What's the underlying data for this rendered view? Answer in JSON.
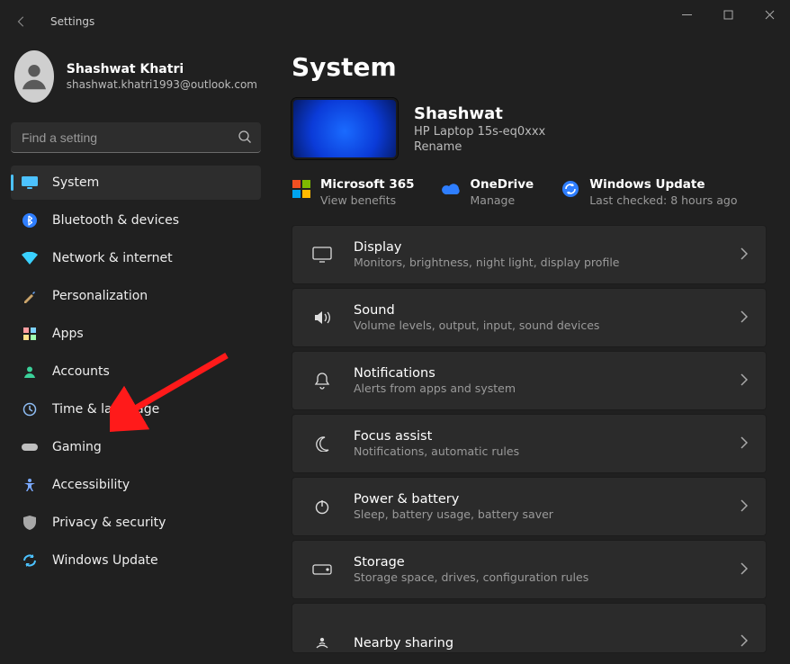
{
  "window": {
    "title": "Settings"
  },
  "user": {
    "name": "Shashwat Khatri",
    "email": "shashwat.khatri1993@outlook.com"
  },
  "search": {
    "placeholder": "Find a setting"
  },
  "nav": [
    {
      "id": "system",
      "label": "System",
      "icon": "🖥️",
      "iconColor": "#4cc2ff",
      "active": true
    },
    {
      "id": "bluetooth",
      "label": "Bluetooth & devices",
      "icon": "BT",
      "iconColor": "#4cc2ff"
    },
    {
      "id": "network",
      "label": "Network & internet",
      "icon": "📶",
      "iconColor": "#4cc2ff"
    },
    {
      "id": "personalization",
      "label": "Personalization",
      "icon": "🖌️",
      "iconColor": "#c9a36a"
    },
    {
      "id": "apps",
      "label": "Apps",
      "icon": "▦",
      "iconColor": "#ff9ea0"
    },
    {
      "id": "accounts",
      "label": "Accounts",
      "icon": "👤",
      "iconColor": "#3bd19a"
    },
    {
      "id": "time",
      "label": "Time & language",
      "icon": "🕑",
      "iconColor": "#8fbef5"
    },
    {
      "id": "gaming",
      "label": "Gaming",
      "icon": "🎮",
      "iconColor": "#bfbfbf"
    },
    {
      "id": "accessibility",
      "label": "Accessibility",
      "icon": "♿",
      "iconColor": "#7aa9ff"
    },
    {
      "id": "privacy",
      "label": "Privacy & security",
      "icon": "🛡️",
      "iconColor": "#a8a8a8"
    },
    {
      "id": "update",
      "label": "Windows Update",
      "icon": "🔄",
      "iconColor": "#4cc2ff"
    }
  ],
  "page": {
    "title": "System",
    "device": {
      "name": "Shashwat",
      "model": "HP Laptop 15s-eq0xxx",
      "rename": "Rename"
    },
    "tiles": [
      {
        "id": "m365",
        "title": "Microsoft 365",
        "sub": "View benefits",
        "icon": "ms"
      },
      {
        "id": "onedrive",
        "title": "OneDrive",
        "sub": "Manage",
        "icon": "cloud"
      },
      {
        "id": "wu",
        "title": "Windows Update",
        "sub": "Last checked: 8 hours ago",
        "icon": "sync"
      }
    ],
    "rows": [
      {
        "id": "display",
        "title": "Display",
        "sub": "Monitors, brightness, night light, display profile",
        "icon": "display"
      },
      {
        "id": "sound",
        "title": "Sound",
        "sub": "Volume levels, output, input, sound devices",
        "icon": "sound"
      },
      {
        "id": "notif",
        "title": "Notifications",
        "sub": "Alerts from apps and system",
        "icon": "bell"
      },
      {
        "id": "focus",
        "title": "Focus assist",
        "sub": "Notifications, automatic rules",
        "icon": "moon"
      },
      {
        "id": "power",
        "title": "Power & battery",
        "sub": "Sleep, battery usage, battery saver",
        "icon": "power"
      },
      {
        "id": "storage",
        "title": "Storage",
        "sub": "Storage space, drives, configuration rules",
        "icon": "drive"
      },
      {
        "id": "nearby",
        "title": "Nearby sharing",
        "sub": "",
        "icon": "share",
        "cut": true
      }
    ]
  }
}
